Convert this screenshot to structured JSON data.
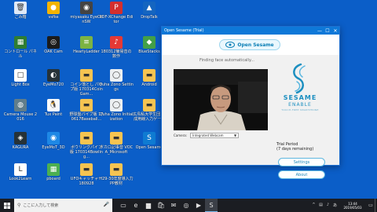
{
  "desktop": {
    "icons": [
      {
        "label": "ごみ箱",
        "icon": "recycle-bin-icon",
        "color": "#dfe9f7",
        "glyph": "🗑"
      },
      {
        "label": "vsfke",
        "icon": "app-icon",
        "color": "#f5b400",
        "glyph": "●"
      },
      {
        "label": "miyasaku EyeConSW",
        "icon": "eye-icon",
        "color": "#444444",
        "glyph": "◉"
      },
      {
        "label": "PDF-XChange Editor",
        "icon": "pdf-icon",
        "color": "#d32f2f",
        "glyph": "P"
      },
      {
        "label": "DropTalk",
        "icon": "droptalk-icon",
        "color": "#1565c0",
        "glyph": "▲"
      },
      {
        "label": "コントロール パネル",
        "icon": "control-panel-icon",
        "color": "#2e7d32",
        "glyph": "▦"
      },
      {
        "label": "OAK Cam",
        "icon": "camera-icon",
        "color": "#1b1b1b",
        "glyph": "◎"
      },
      {
        "label": "HearlyLadder",
        "icon": "ladder-icon",
        "color": "#7cb342",
        "glyph": "≡"
      },
      {
        "label": "180312簡易音の数作",
        "icon": "file-icon",
        "color": "#e53935",
        "glyph": "♪"
      },
      {
        "label": "BlueStacks",
        "icon": "bluestacks-icon",
        "color": "#43a047",
        "glyph": "◆"
      },
      {
        "label": "Light Box",
        "icon": "lightbox-icon",
        "color": "#ffffff",
        "glyph": "□"
      },
      {
        "label": "EyeMo720",
        "icon": "eyemo-icon",
        "color": "#263238",
        "glyph": "◐"
      },
      {
        "label": "コイン落とし パイプ版 170314CoinGam...",
        "icon": "folder-icon",
        "color": "#f6c451",
        "glyph": "▬"
      },
      {
        "label": "Quha Zono Settings",
        "icon": "quha-icon",
        "color": "#eceff1",
        "glyph": "◯"
      },
      {
        "label": "Android",
        "icon": "folder-icon",
        "color": "#f6c451",
        "glyph": "▬"
      },
      {
        "label": "Camera Mouse 2016",
        "icon": "camera-mouse-icon",
        "color": "#607d8b",
        "glyph": "◍"
      },
      {
        "label": "Tux Paint",
        "icon": "tux-icon",
        "color": "#fafafa",
        "glyph": "🐧"
      },
      {
        "label": "野球盤パイプ版 170617Baseball...",
        "icon": "folder-icon",
        "color": "#f6c451",
        "glyph": "▬"
      },
      {
        "label": "Quha Zono Initialization",
        "icon": "quha-icon",
        "color": "#eceff1",
        "glyph": "◯"
      },
      {
        "label": "広島私大学生団 作成用線入力ゲーム",
        "icon": "folder-icon",
        "color": "#f6c451",
        "glyph": "▬"
      },
      {
        "label": "KAGURA",
        "icon": "kagura-icon",
        "color": "#263238",
        "glyph": "◈"
      },
      {
        "label": "EyeMoT_3D",
        "icon": "eyemot-icon",
        "color": "#1e88e5",
        "glyph": "◉"
      },
      {
        "label": "ボウリングパイプ版 170314Bowling...",
        "icon": "folder-icon",
        "color": "#f6c451",
        "glyph": "▬"
      },
      {
        "label": "ボカロ記事音 VOCA_Microsoft",
        "icon": "folder-icon",
        "color": "#f6c451",
        "glyph": "▬"
      },
      {
        "label": "Open Sesame",
        "icon": "sesame-icon",
        "color": "#0f7bd2",
        "glyph": "S"
      },
      {
        "label": "Look2Learn",
        "icon": "look2learn-icon",
        "color": "#ffffff",
        "glyph": "L"
      },
      {
        "label": "pboard",
        "icon": "pboard-icon",
        "color": "#4caf50",
        "glyph": "▦"
      },
      {
        "label": "UFOキャッチャー 180928",
        "icon": "folder-icon",
        "color": "#f6c451",
        "glyph": "▬"
      },
      {
        "label": "H29-30年度導入力PP教材",
        "icon": "folder-icon",
        "color": "#f6c451",
        "glyph": "▬"
      }
    ]
  },
  "window": {
    "title": "Open Sesame (Trial)",
    "minimize": "—",
    "maximize": "☐",
    "close": "✕",
    "brand_button": "Open Sesame",
    "status": "Finding face automatically...",
    "camera_label": "Camera:",
    "camera_value": "Integrated Webcam",
    "logo_line1": "SESAME",
    "logo_line2": "ENABLE",
    "logo_tagline": "TOUCH-FREE SMARTPHONE",
    "trial_line1": "Trial Period",
    "trial_line2": "(7 days remaining)",
    "settings_button": "Settings",
    "about_button": "About"
  },
  "taskbar": {
    "search_placeholder": "ここに入力して検索",
    "mic_icon": "🎤",
    "icons": [
      {
        "glyph": "▭",
        "name": "task-view-icon"
      },
      {
        "glyph": "e",
        "name": "edge-icon"
      },
      {
        "glyph": "▆",
        "name": "file-explorer-icon"
      },
      {
        "glyph": "🛍",
        "name": "store-icon"
      },
      {
        "glyph": "✉",
        "name": "mail-icon"
      },
      {
        "glyph": "◎",
        "name": "chrome-icon"
      },
      {
        "glyph": "▶",
        "name": "media-icon"
      },
      {
        "glyph": "S",
        "name": "open-sesame-taskbar-icon"
      }
    ],
    "time": "13:44",
    "date": "2019/05/03",
    "tray_icons": [
      "^",
      "▤",
      "♪",
      "あ"
    ]
  }
}
